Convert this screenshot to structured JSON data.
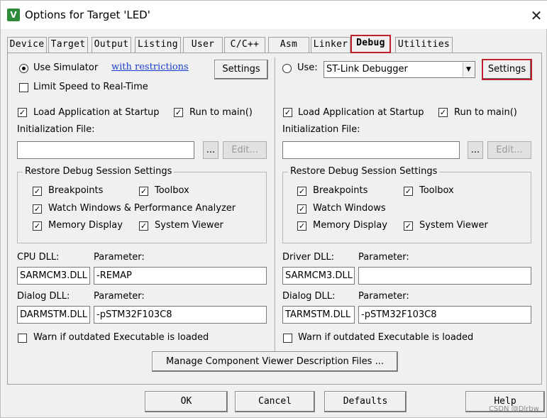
{
  "window": {
    "title": "Options for Target 'LED'",
    "close_glyph": "✕",
    "app_icon_letter": "V"
  },
  "tabs": [
    {
      "label": "Device"
    },
    {
      "label": "Target"
    },
    {
      "label": "Output"
    },
    {
      "label": "Listing"
    },
    {
      "label": "User"
    },
    {
      "label": "C/C++"
    },
    {
      "label": "Asm"
    },
    {
      "label": "Linker"
    },
    {
      "label": "Debug",
      "active": true
    },
    {
      "label": "Utilities"
    }
  ],
  "left": {
    "use_simulator_label": "Use Simulator",
    "use_simulator_checked": true,
    "restrictions_link": "with restrictions",
    "settings_label": "Settings",
    "limit_speed_label": "Limit Speed to Real-Time",
    "limit_speed_checked": false,
    "load_app_label": "Load Application at Startup",
    "load_app_checked": true,
    "run_to_main_label": "Run to main()",
    "run_to_main_checked": true,
    "init_file_label": "Initialization File:",
    "init_file_value": "",
    "browse_label": "...",
    "edit_label": "Edit...",
    "restore_group_title": "Restore Debug Session Settings",
    "breakpoints_label": "Breakpoints",
    "toolbox_label": "Toolbox",
    "watch_label": "Watch Windows & Performance Analyzer",
    "memory_label": "Memory Display",
    "system_viewer_label": "System Viewer",
    "cpu_dll_label": "CPU DLL:",
    "cpu_dll_value": "SARMCM3.DLL",
    "cpu_param_label": "Parameter:",
    "cpu_param_value": "-REMAP",
    "dialog_dll_label": "Dialog DLL:",
    "dialog_dll_value": "DARMSTM.DLL",
    "dialog_param_label": "Parameter:",
    "dialog_param_value": "-pSTM32F103C8",
    "warn_label": "Warn if outdated Executable is loaded",
    "warn_checked": false
  },
  "right": {
    "use_label": "Use:",
    "use_checked": false,
    "debugger_value": "ST-Link Debugger",
    "settings_label": "Settings",
    "load_app_label": "Load Application at Startup",
    "load_app_checked": true,
    "run_to_main_label": "Run to main()",
    "run_to_main_checked": true,
    "init_file_label": "Initialization File:",
    "init_file_value": "",
    "browse_label": "...",
    "edit_label": "Edit...",
    "restore_group_title": "Restore Debug Session Settings",
    "breakpoints_label": "Breakpoints",
    "toolbox_label": "Toolbox",
    "watch_label": "Watch Windows",
    "memory_label": "Memory Display",
    "system_viewer_label": "System Viewer",
    "driver_dll_label": "Driver DLL:",
    "driver_dll_value": "SARMCM3.DLL",
    "driver_param_label": "Parameter:",
    "driver_param_value": "",
    "dialog_dll_label": "Dialog DLL:",
    "dialog_dll_value": "TARMSTM.DLL",
    "dialog_param_label": "Parameter:",
    "dialog_param_value": "-pSTM32F103C8",
    "warn_label": "Warn if outdated Executable is loaded",
    "warn_checked": false
  },
  "manage_button_label": "Manage Component Viewer Description Files ...",
  "footer": {
    "ok_label": "OK",
    "cancel_label": "Cancel",
    "defaults_label": "Defaults",
    "help_label": "Help"
  },
  "watermark": "CSDN @Dlrbw",
  "colors": {
    "highlight_border": "#c0202a",
    "link": "#1a3cd0",
    "dialog_bg": "#f0f0f0",
    "app_icon_green": "#2e8b3a"
  }
}
